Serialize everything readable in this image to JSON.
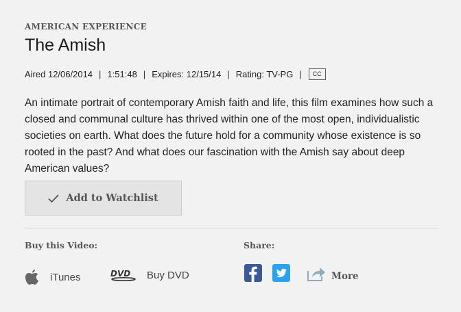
{
  "program": {
    "series": "AMERICAN EXPERIENCE",
    "title": "The Amish"
  },
  "meta": {
    "aired": "Aired 12/06/2014",
    "duration": "1:51:48",
    "expires": "Expires: 12/15/14",
    "rating": "Rating: TV-PG",
    "separator": "|",
    "cc": "CC"
  },
  "description": "An intimate portrait of contemporary Amish faith and life, this film examines how such a closed and communal culture has thrived within one of the most open, individualistic societies on earth. What does the future hold for a community whose existence is so rooted in the past? And what does our fascination with the Amish say about deep American values?",
  "watchlist": {
    "label": "Add to Watchlist",
    "icon": "check-icon"
  },
  "buy": {
    "heading": "Buy this Video:",
    "items": [
      {
        "label": "iTunes",
        "icon": "apple-icon"
      },
      {
        "label": "Buy DVD",
        "icon": "dvd-icon"
      }
    ]
  },
  "share": {
    "heading": "Share:",
    "more_label": "More",
    "icons": [
      "facebook-icon",
      "twitter-icon",
      "share-arrow-icon"
    ]
  },
  "colors": {
    "facebook": "#3b5998",
    "twitter": "#2aa3ef",
    "background": "#f2f2f2"
  }
}
